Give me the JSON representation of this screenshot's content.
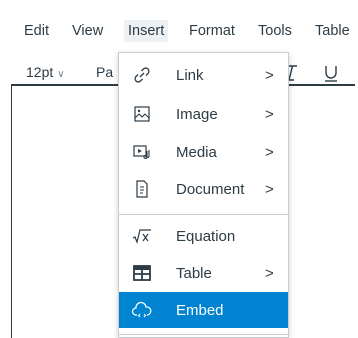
{
  "menubar": {
    "items": [
      "Edit",
      "View",
      "Insert",
      "Format",
      "Tools",
      "Table"
    ],
    "active": "Insert"
  },
  "toolbar": {
    "font_size": "12pt",
    "paragraph_partial": "Pa"
  },
  "insert_menu": {
    "items": [
      {
        "label": "Link",
        "icon": "link-icon",
        "has_submenu": true,
        "arrow": ">"
      },
      {
        "label": "Image",
        "icon": "image-icon",
        "has_submenu": true,
        "arrow": ">"
      },
      {
        "label": "Media",
        "icon": "media-icon",
        "has_submenu": true,
        "arrow": ">"
      },
      {
        "label": "Document",
        "icon": "document-icon",
        "has_submenu": true,
        "arrow": ">"
      },
      {
        "label": "Equation",
        "icon": "equation-icon",
        "has_submenu": false
      },
      {
        "label": "Table",
        "icon": "table-icon",
        "has_submenu": true,
        "arrow": ">"
      },
      {
        "label": "Embed",
        "icon": "embed-cloud-icon",
        "has_submenu": false,
        "highlighted": true
      }
    ]
  },
  "colors": {
    "highlight": "#0084d1",
    "text": "#2d3b45",
    "border": "#c7cdd1"
  }
}
